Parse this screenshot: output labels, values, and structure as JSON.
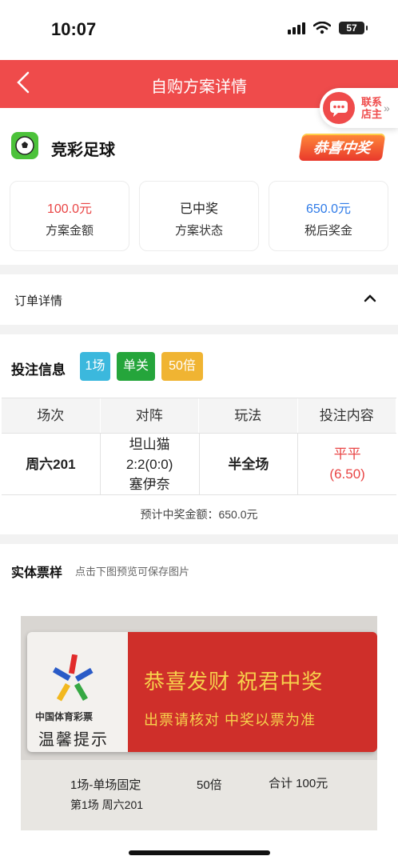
{
  "status": {
    "time": "10:07",
    "battery": "57"
  },
  "nav": {
    "title": "自购方案详情"
  },
  "contact": {
    "line1": "联系",
    "line2": "店主"
  },
  "game": {
    "name": "竞彩足球",
    "badge": "恭喜中奖"
  },
  "stats": [
    {
      "value": "100.0元",
      "label": "方案金额",
      "color": "#e94545"
    },
    {
      "value": "已中奖",
      "label": "方案状态",
      "color": "#222222"
    },
    {
      "value": "650.0元",
      "label": "税后奖金",
      "color": "#2f7be8"
    }
  ],
  "order": {
    "title": "订单详情"
  },
  "bet": {
    "title": "投注信息",
    "tags": [
      {
        "label": "1场",
        "color": "#3bb8dd"
      },
      {
        "label": "单关",
        "color": "#25a53b"
      },
      {
        "label": "50倍",
        "color": "#f0b432"
      }
    ],
    "headers": [
      "场次",
      "对阵",
      "玩法",
      "投注内容"
    ],
    "row": {
      "session": "周六201",
      "home": "坦山猫",
      "score": "2:2(0:0)",
      "away": "塞伊奈",
      "play": "半全场",
      "pick": "平平",
      "odds": "(6.50)"
    },
    "estimate": "预计中奖金额：650.0元"
  },
  "ticket": {
    "title": "实体票样",
    "subtitle": "点击下图预览可保存图片",
    "lottery_name": "中国体育彩票",
    "tips": "温馨提示",
    "slogan": "恭喜发财 祝君中奖",
    "slogan2": "出票请核对 中奖以票为准",
    "line1": "1场-单场固定",
    "mult": "50倍",
    "total": "合计 100元",
    "line2": "第1场  周六201"
  }
}
